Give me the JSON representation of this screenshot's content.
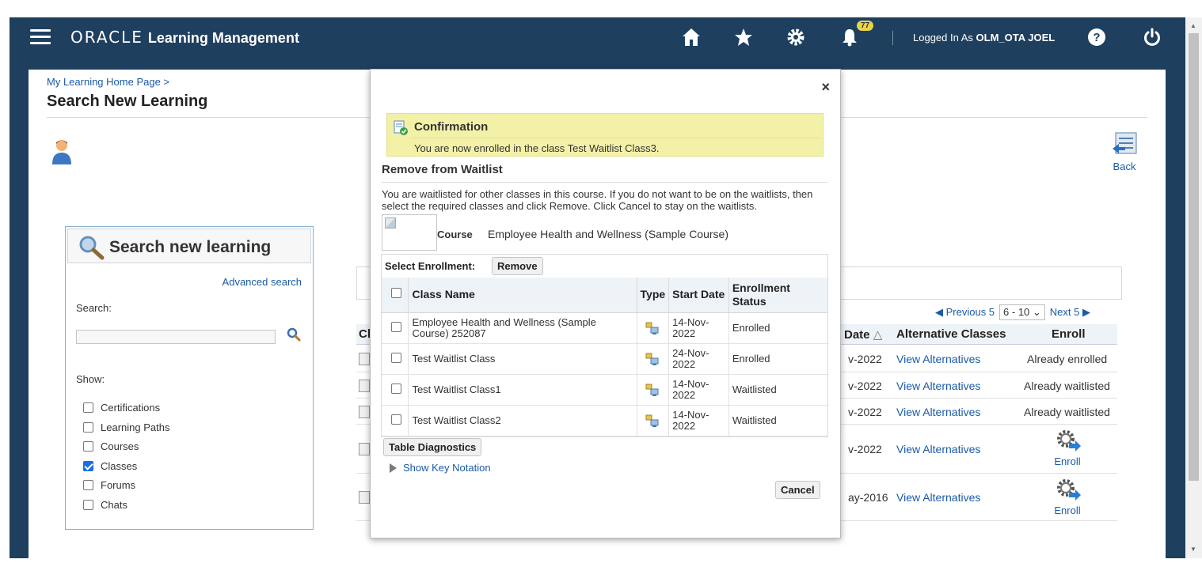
{
  "header": {
    "brand_oracle": "ORACLE",
    "brand_app": "Learning Management",
    "notification_count": "77",
    "logged_in_prefix": "Logged In As",
    "logged_in_user": "OLM_OTA JOEL"
  },
  "page": {
    "breadcrumb": "My Learning Home Page  >",
    "title": "Search New Learning",
    "back_label": "Back"
  },
  "search_panel": {
    "heading": "Search new learning",
    "advanced_search": "Advanced search",
    "search_label": "Search:",
    "search_value": "",
    "show_label": "Show:",
    "filters": [
      {
        "label": "Certifications",
        "checked": false
      },
      {
        "label": "Learning Paths",
        "checked": false
      },
      {
        "label": "Courses",
        "checked": false
      },
      {
        "label": "Classes",
        "checked": true
      },
      {
        "label": "Forums",
        "checked": false
      },
      {
        "label": "Chats",
        "checked": false
      }
    ]
  },
  "results": {
    "pager_previous": "Previous 5",
    "pager_range": "6 - 10",
    "pager_next": "Next 5",
    "headers": {
      "date": "Date",
      "alternative_classes": "Alternative Classes",
      "enroll": "Enroll"
    },
    "rows": [
      {
        "date": "v-2022",
        "alternatives": "View Alternatives",
        "enroll": "Already enrolled"
      },
      {
        "date": "v-2022",
        "alternatives": "View Alternatives",
        "enroll": "Already waitlisted"
      },
      {
        "date": "v-2022",
        "alternatives": "View Alternatives",
        "enroll": "Already waitlisted"
      },
      {
        "date": "v-2022",
        "alternatives": "View Alternatives",
        "enroll": "Enroll"
      },
      {
        "date": "ay-2016",
        "alternatives": "View Alternatives",
        "enroll": "Enroll"
      }
    ],
    "partial_header": "Cl"
  },
  "modal": {
    "close_label": "×",
    "confirmation_title": "Confirmation",
    "confirmation_message": "You are now enrolled in the class Test Waitlist Class3.",
    "section_title": "Remove from Waitlist",
    "description": "You are waitlisted for other classes in this course. If you do not want to be on the waitlists, then select the required classes and click Remove. Click Cancel to stay on the waitlists.",
    "course_label": "Course",
    "course_value": "Employee Health and Wellness (Sample Course)",
    "select_enrollment_label": "Select Enrollment:",
    "remove_button": "Remove",
    "columns": {
      "class_name": "Class Name",
      "type": "Type",
      "start_date": "Start Date",
      "enrollment_status": "Enrollment Status"
    },
    "rows": [
      {
        "class_name": "Employee Health and Wellness (Sample Course) 252087",
        "start_date": "14-Nov-2022",
        "status": "Enrolled"
      },
      {
        "class_name": "Test Waitlist Class",
        "start_date": "24-Nov-2022",
        "status": "Enrolled"
      },
      {
        "class_name": "Test Waitlist Class1",
        "start_date": "14-Nov-2022",
        "status": "Waitlisted"
      },
      {
        "class_name": "Test Waitlist Class2",
        "start_date": "14-Nov-2022",
        "status": "Waitlisted"
      }
    ],
    "table_diagnostics_button": "Table Diagnostics",
    "show_key_notation": "Show Key Notation",
    "cancel_button": "Cancel"
  },
  "colors": {
    "header_bg": "#1f3f5f",
    "link": "#1a5aa8",
    "confirmation_bg": "#f3f1a8",
    "table_header_bg": "#eef3f7"
  }
}
